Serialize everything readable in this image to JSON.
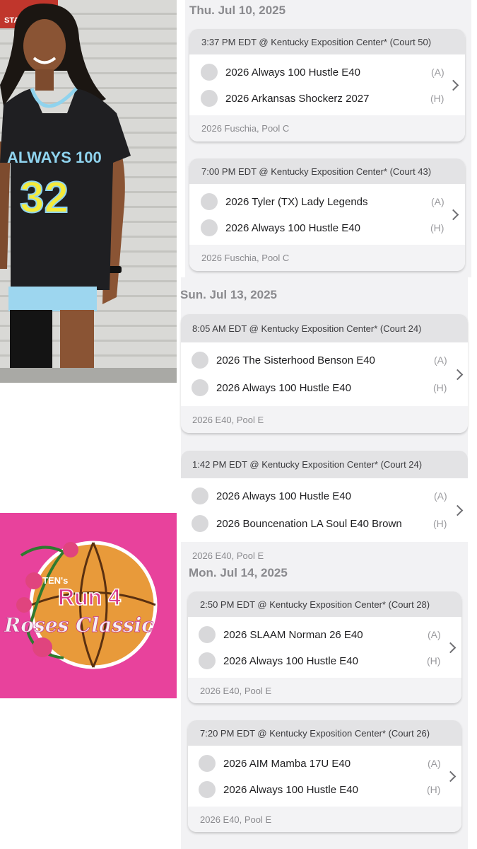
{
  "photo": {
    "jersey_team": "ALWAYS 100",
    "jersey_number": "32",
    "sign_text": "STAFF ONLY"
  },
  "logo": {
    "top_text": "TEN's",
    "main_text": "Run 4",
    "script_text": "Roses Classic",
    "background_color": "#e8429c"
  },
  "days": [
    {
      "date": "Thu. Jul 10, 2025",
      "games": [
        {
          "header": "3:37 PM EDT @ Kentucky Exposition Center* (Court 50)",
          "away": "2026 Always 100 Hustle E40",
          "away_tag": "(A)",
          "home": "2026 Arkansas Shockerz 2027",
          "home_tag": "(H)",
          "pool": "2026 Fuschia, Pool C"
        },
        {
          "header": "7:00 PM EDT @ Kentucky Exposition Center* (Court 43)",
          "away": "2026 Tyler (TX) Lady Legends",
          "away_tag": "(A)",
          "home": "2026 Always 100 Hustle E40",
          "home_tag": "(H)",
          "pool": "2026 Fuschia, Pool C"
        }
      ]
    },
    {
      "date": "Sun. Jul 13, 2025",
      "games": [
        {
          "header": "8:05 AM EDT @ Kentucky Exposition Center* (Court 24)",
          "away": "2026 The Sisterhood Benson E40",
          "away_tag": "(A)",
          "home": "2026 Always 100 Hustle E40",
          "home_tag": "(H)",
          "pool": "2026 E40, Pool E"
        },
        {
          "header": "1:42 PM EDT @ Kentucky Exposition Center* (Court 24)",
          "away": "2026 Always 100 Hustle E40",
          "away_tag": "(A)",
          "home": "2026 Bouncenation LA Soul E40 Brown",
          "home_tag": "(H)",
          "pool": "2026 E40, Pool E"
        }
      ]
    },
    {
      "date": "Mon. Jul 14, 2025",
      "games": [
        {
          "header": "2:50 PM EDT @ Kentucky Exposition Center* (Court 28)",
          "away": "2026 SLAAM Norman 26 E40",
          "away_tag": "(A)",
          "home": "2026 Always 100 Hustle E40",
          "home_tag": "(H)",
          "pool": "2026 E40, Pool E"
        },
        {
          "header": "7:20 PM EDT @ Kentucky Exposition Center* (Court 26)",
          "away": "2026 AIM Mamba 17U E40",
          "away_tag": "(A)",
          "home": "2026 Always 100 Hustle E40",
          "home_tag": "(H)",
          "pool": "2026 E40, Pool E"
        }
      ]
    }
  ],
  "icons": {
    "chevron": "chevron-right-icon",
    "team_logo": "team-logo-placeholder-icon"
  }
}
